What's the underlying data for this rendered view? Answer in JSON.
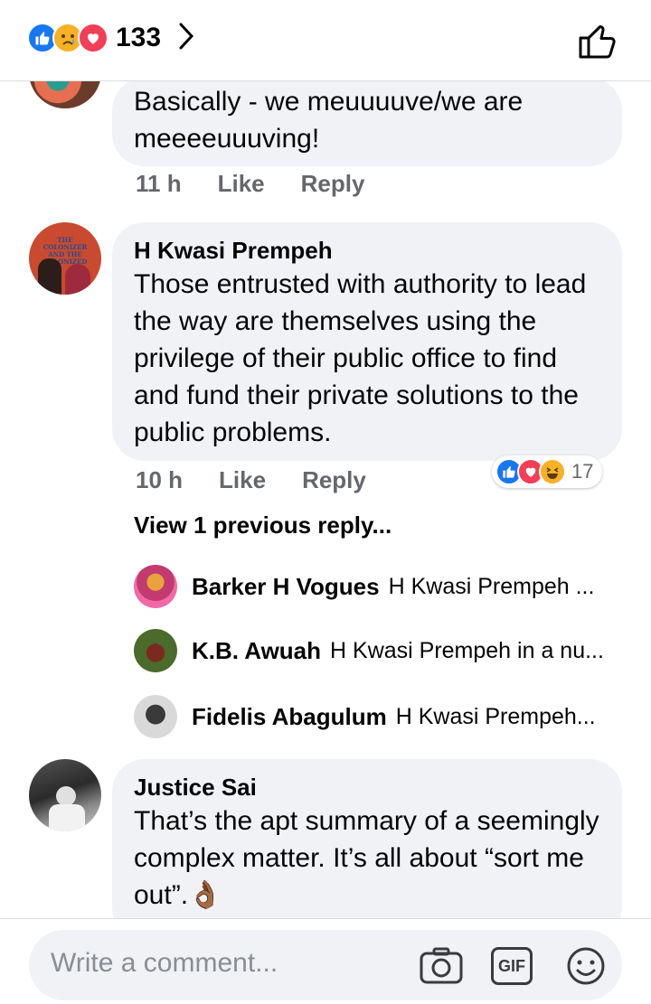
{
  "header": {
    "reaction_count": "133",
    "reaction_icons": [
      "like-icon",
      "sad-icon",
      "love-icon"
    ]
  },
  "comments": [
    {
      "text": "Basically - we meuuuuve/we are meeeeuuuving!",
      "time": "11 h",
      "like_label": "Like",
      "reply_label": "Reply"
    },
    {
      "author": "H Kwasi Prempeh",
      "avatar_text": "THE COLONIZER AND THE COLONIZED",
      "text": "Those entrusted with authority to lead the way are themselves using the privilege of their public office to find and fund their private solutions to the public problems.",
      "time": "10 h",
      "like_label": "Like",
      "reply_label": "Reply",
      "reactions_count": "17",
      "view_previous": "View 1 previous reply...",
      "replies": [
        {
          "author": "Barker H Vogues",
          "snippet": "H Kwasi Prempeh ..."
        },
        {
          "author": "K.B. Awuah",
          "snippet": "H Kwasi Prempeh in a nu..."
        },
        {
          "author": "Fidelis Abagulum",
          "snippet": "H Kwasi Prempeh..."
        }
      ]
    },
    {
      "author": "Justice Sai",
      "text": "That’s the apt summary of a seemingly complex matter. It’s all about “sort me out”.👌🏾"
    }
  ],
  "composer": {
    "placeholder": "Write a comment...",
    "gif_label": "GIF"
  },
  "colors": {
    "like_blue": "#1877f2",
    "love_red": "#f33e58",
    "haha_yellow": "#f7b125",
    "bubble_bg": "#f0f2f5",
    "meta_gray": "#65676b"
  }
}
